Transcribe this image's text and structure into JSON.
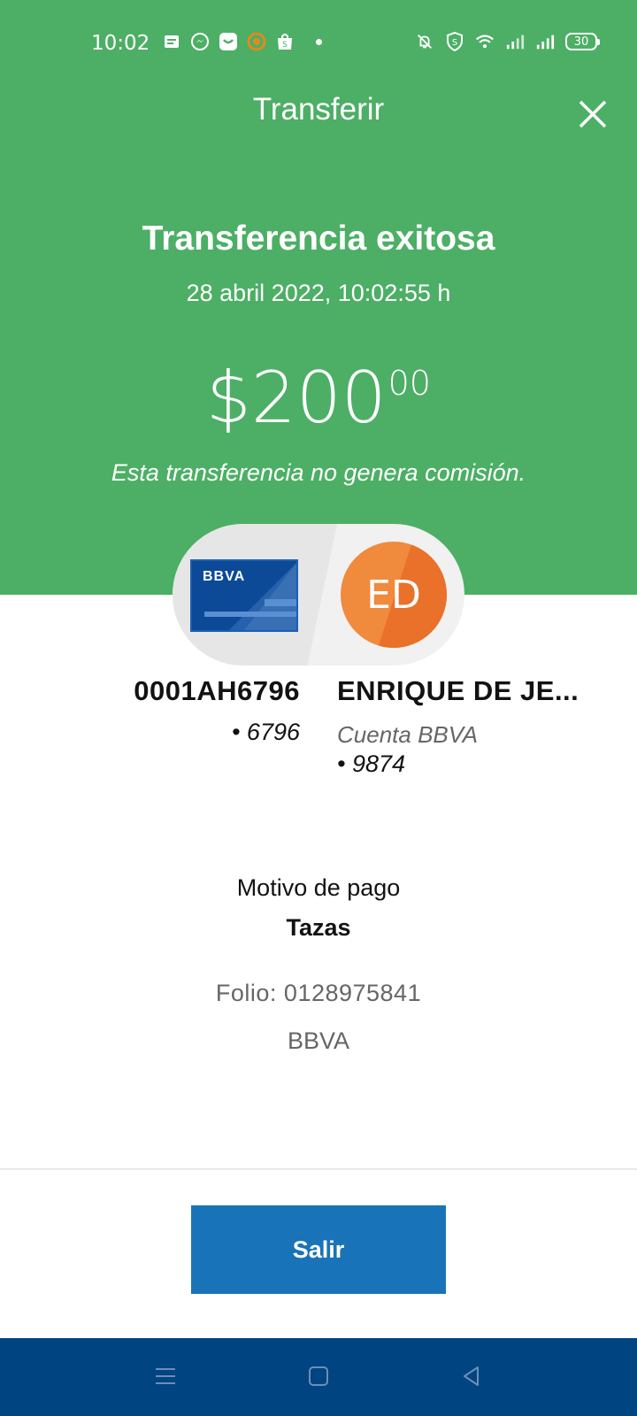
{
  "status_bar": {
    "time": "10:02",
    "battery": "30",
    "icons_left": [
      "message-icon",
      "messenger-icon",
      "chat-app-icon",
      "orange-app-icon",
      "shop-icon"
    ],
    "icons_right": [
      "mute-icon",
      "shield-icon",
      "wifi-icon",
      "signal-icon",
      "signal-icon"
    ]
  },
  "header": {
    "title": "Transferir"
  },
  "result": {
    "title": "Transferencia exitosa",
    "date": "28 abril 2022, 10:02:55 h",
    "amount_main": "$200",
    "amount_cents": "00",
    "note": "Esta transferencia no genera comisión."
  },
  "from_account": {
    "card_brand": "BBVA",
    "name": "0001AH6796",
    "number": "• 6796"
  },
  "to_account": {
    "initials": "ED",
    "name": "ENRIQUE DE JE...",
    "type": "Cuenta BBVA",
    "number": "• 9874"
  },
  "details": {
    "motive_label": "Motivo de pago",
    "motive_value": "Tazas",
    "folio": "Folio: 0128975841",
    "bank": "BBVA"
  },
  "actions": {
    "exit_label": "Salir"
  },
  "colors": {
    "header_bg": "#4caf65",
    "button_bg": "#1973b8",
    "nav_bg": "#004481",
    "avatar": "#f08a3d"
  }
}
